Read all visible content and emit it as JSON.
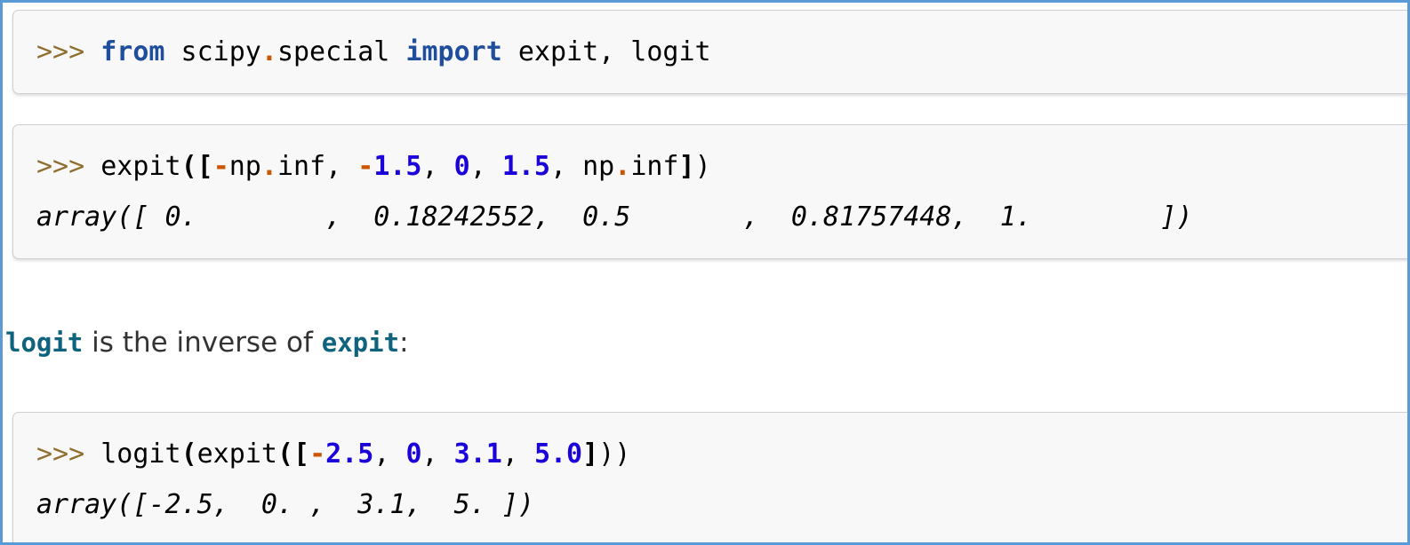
{
  "page": {
    "kind": "scipy-documentation-examples",
    "frame_color": "#5b9bd5",
    "background": "#ffffff",
    "block_background": "#f8f8f8",
    "block_border_color": "#cfcfcf"
  },
  "colors": {
    "prompt": "#8f6f30",
    "keyword": "#1f4e9c",
    "number": "#1a00d9",
    "operator": "#cc5500",
    "code_reference": "#10637f",
    "text": "#333333"
  },
  "blocks": [
    {
      "id": "import-block",
      "lines": [
        {
          "type": "input",
          "text": ">>> from scipy.special import expit, logit",
          "tokens": [
            {
              "t": ">>>",
              "k": "prompt"
            },
            {
              "t": " ",
              "k": "plain"
            },
            {
              "t": "from",
              "k": "kw"
            },
            {
              "t": " scipy",
              "k": "name"
            },
            {
              "t": ".",
              "k": "op"
            },
            {
              "t": "special ",
              "k": "name"
            },
            {
              "t": "import",
              "k": "kw"
            },
            {
              "t": " expit, logit",
              "k": "name"
            }
          ]
        }
      ]
    },
    {
      "id": "expit-block",
      "lines": [
        {
          "type": "input",
          "text": ">>> expit([-np.inf, -1.5, 0, 1.5, np.inf])",
          "tokens": [
            {
              "t": ">>>",
              "k": "prompt"
            },
            {
              "t": " expit",
              "k": "name"
            },
            {
              "t": "([",
              "k": "punct"
            },
            {
              "t": "-",
              "k": "op"
            },
            {
              "t": "np",
              "k": "name"
            },
            {
              "t": ".",
              "k": "op"
            },
            {
              "t": "inf",
              "k": "name"
            },
            {
              "t": ", ",
              "k": "comma"
            },
            {
              "t": "-",
              "k": "op"
            },
            {
              "t": "1.5",
              "k": "num"
            },
            {
              "t": ", ",
              "k": "comma"
            },
            {
              "t": "0",
              "k": "num"
            },
            {
              "t": ", ",
              "k": "comma"
            },
            {
              "t": "1.5",
              "k": "num"
            },
            {
              "t": ", ",
              "k": "comma"
            },
            {
              "t": "np",
              "k": "name"
            },
            {
              "t": ".",
              "k": "op"
            },
            {
              "t": "inf",
              "k": "name"
            },
            {
              "t": "]",
              "k": "punct"
            },
            {
              "t": ")",
              "k": "plain"
            }
          ]
        },
        {
          "type": "output",
          "text": "array([ 0.        ,  0.18242552,  0.5       ,  0.81757448,  1.        ])"
        }
      ]
    },
    {
      "id": "logit-block",
      "lines": [
        {
          "type": "input",
          "text": ">>> logit(expit([-2.5, 0, 3.1, 5.0]))",
          "tokens": [
            {
              "t": ">>>",
              "k": "prompt"
            },
            {
              "t": " logit",
              "k": "name"
            },
            {
              "t": "(",
              "k": "punct"
            },
            {
              "t": "expit",
              "k": "name"
            },
            {
              "t": "([",
              "k": "punct"
            },
            {
              "t": "-",
              "k": "op"
            },
            {
              "t": "2.5",
              "k": "num"
            },
            {
              "t": ", ",
              "k": "comma"
            },
            {
              "t": "0",
              "k": "num"
            },
            {
              "t": ", ",
              "k": "comma"
            },
            {
              "t": "3.1",
              "k": "num"
            },
            {
              "t": ", ",
              "k": "comma"
            },
            {
              "t": "5.0",
              "k": "num"
            },
            {
              "t": "]",
              "k": "punct"
            },
            {
              "t": "))",
              "k": "plain"
            }
          ]
        },
        {
          "type": "output",
          "text": "array([-2.5,  0. ,  3.1,  5. ])"
        }
      ]
    }
  ],
  "prose": {
    "ref_first": "logit",
    "middle": " is the inverse of ",
    "ref_second": "expit",
    "suffix": ":"
  }
}
